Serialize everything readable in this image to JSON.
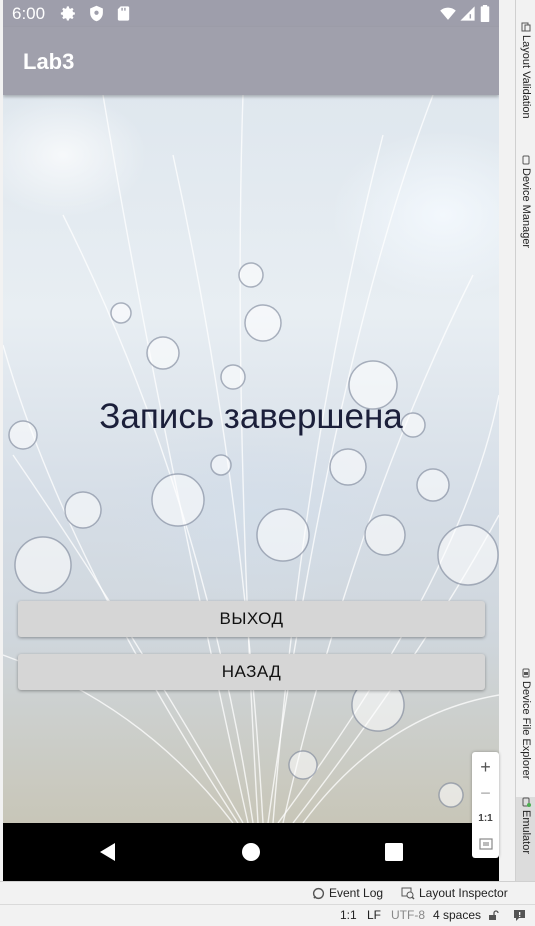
{
  "status_bar": {
    "time": "6:00",
    "icons": [
      "settings-icon",
      "shield-icon",
      "sd-card-icon",
      "wifi-icon",
      "signal-icon",
      "battery-icon"
    ]
  },
  "app_bar": {
    "title": "Lab3"
  },
  "content": {
    "message": "Запись завершена",
    "exit_button": "ВЫХОД",
    "back_button": "НАЗАД"
  },
  "nav_bar": {
    "icons": [
      "back-triangle-icon",
      "home-circle-icon",
      "recents-square-icon"
    ]
  },
  "zoom_controls": {
    "plus": "+",
    "minus": "−",
    "one_to_one": "1:1"
  },
  "right_panel": {
    "tabs": [
      {
        "label": "Layout Validation"
      },
      {
        "label": "Device Manager"
      },
      {
        "label": "Device File Explorer"
      },
      {
        "label": "Emulator"
      }
    ]
  },
  "bottom_toolbar": {
    "event_log": "Event Log",
    "layout_inspector": "Layout Inspector"
  },
  "status_line": {
    "position": "1:1",
    "line_separator": "LF",
    "encoding": "UTF-8",
    "indent": "4 spaces"
  },
  "colors": {
    "app_bar": "#a0a0ac",
    "status_bar": "#9e9eab",
    "button": "#d6d6d6",
    "message_text": "#1b1f3a"
  }
}
